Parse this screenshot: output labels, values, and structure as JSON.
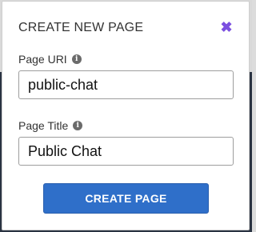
{
  "modal": {
    "title": "CREATE NEW PAGE",
    "close_icon": "close-icon",
    "close_glyph": "✖",
    "accent_color": "#7b4fe0"
  },
  "fields": {
    "uri": {
      "label": "Page URI",
      "value": "public-chat",
      "info_icon": "info-icon",
      "info_glyph": "i"
    },
    "title": {
      "label": "Page Title",
      "value": "Public Chat",
      "info_icon": "info-icon",
      "info_glyph": "i"
    }
  },
  "actions": {
    "create_label": "CREATE PAGE",
    "button_color": "#2f6fc9"
  }
}
